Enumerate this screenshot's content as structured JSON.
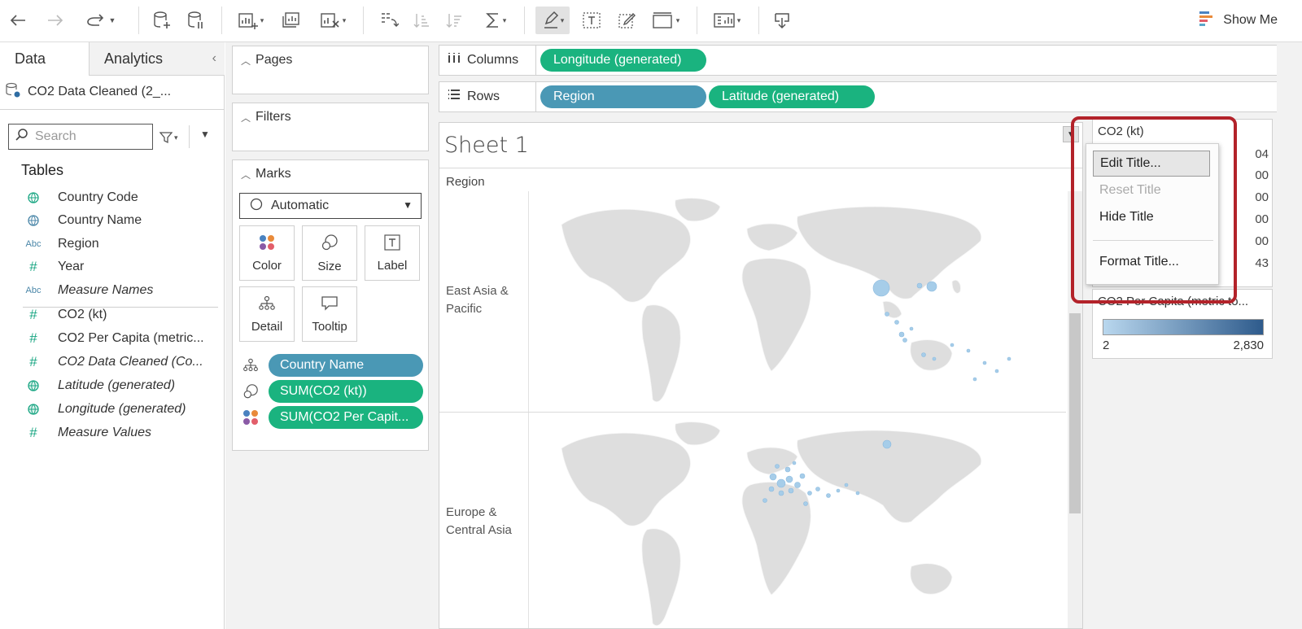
{
  "toolbar": {
    "show_me_label": "Show Me"
  },
  "data_pane": {
    "tabs": [
      {
        "label": "Data"
      },
      {
        "label": "Analytics"
      }
    ],
    "data_source": "CO2 Data Cleaned (2_...",
    "search_placeholder": "Search",
    "tables_title": "Tables",
    "fields": [
      {
        "label": "Country Code",
        "icon": "globe-icon",
        "italic": false
      },
      {
        "label": "Country Name",
        "icon": "globe-icon",
        "italic": false
      },
      {
        "label": "Region",
        "icon": "abc",
        "italic": false
      },
      {
        "label": "Year",
        "icon": "hash",
        "italic": false
      },
      {
        "label": "Measure Names",
        "icon": "abc",
        "italic": true
      },
      {
        "label": "CO2 (kt)",
        "icon": "hash",
        "italic": false
      },
      {
        "label": "CO2 Per Capita (metric...",
        "icon": "hash",
        "italic": false
      },
      {
        "label": "CO2 Data Cleaned (Co...",
        "icon": "hash",
        "italic": true
      },
      {
        "label": "Latitude (generated)",
        "icon": "globe-icon",
        "italic": true
      },
      {
        "label": "Longitude (generated)",
        "icon": "globe-icon",
        "italic": true
      },
      {
        "label": "Measure Values",
        "icon": "hash",
        "italic": true
      }
    ]
  },
  "cards": {
    "pages_title": "Pages",
    "filters_title": "Filters",
    "marks_title": "Marks",
    "mark_type": "Automatic",
    "mark_buttons": [
      {
        "label": "Color"
      },
      {
        "label": "Size"
      },
      {
        "label": "Label"
      },
      {
        "label": "Detail"
      },
      {
        "label": "Tooltip"
      }
    ],
    "mark_pills": [
      {
        "label": "Country Name",
        "color": "#4a98b5"
      },
      {
        "label": "SUM(CO2 (kt))",
        "color": "#1ab37f"
      },
      {
        "label": "SUM(CO2 Per Capit...",
        "color": "#1ab37f"
      }
    ]
  },
  "shelves": {
    "columns_label": "Columns",
    "rows_label": "Rows",
    "columns_pills": [
      "Longitude (generated)"
    ],
    "rows_pills": [
      "Region",
      "Latitude (generated)"
    ]
  },
  "sheet": {
    "title": "Sheet 1",
    "region_header": "Region",
    "rows": [
      {
        "label_line1": "East Asia &",
        "label_line2": "Pacific"
      },
      {
        "label_line1": "Europe &",
        "label_line2": "Central Asia"
      }
    ]
  },
  "legend_size": {
    "title": "CO2 (kt)",
    "values": [
      "04",
      "00",
      "00",
      "00",
      "00",
      "43"
    ]
  },
  "legend_color": {
    "title": "CO2 Per Capita (metric to...",
    "min": "2",
    "max": "2,830"
  },
  "context_menu": {
    "items": [
      {
        "label": "Edit Title...",
        "state": "hover"
      },
      {
        "label": "Reset Title",
        "state": "disabled"
      },
      {
        "label": "Hide Title",
        "state": "normal"
      },
      {
        "label": "Format Title...",
        "state": "normal"
      }
    ]
  },
  "colors": {
    "highlight": "#b3232a",
    "pill_blue": "#4a98b5",
    "pill_green": "#1ab37f"
  }
}
